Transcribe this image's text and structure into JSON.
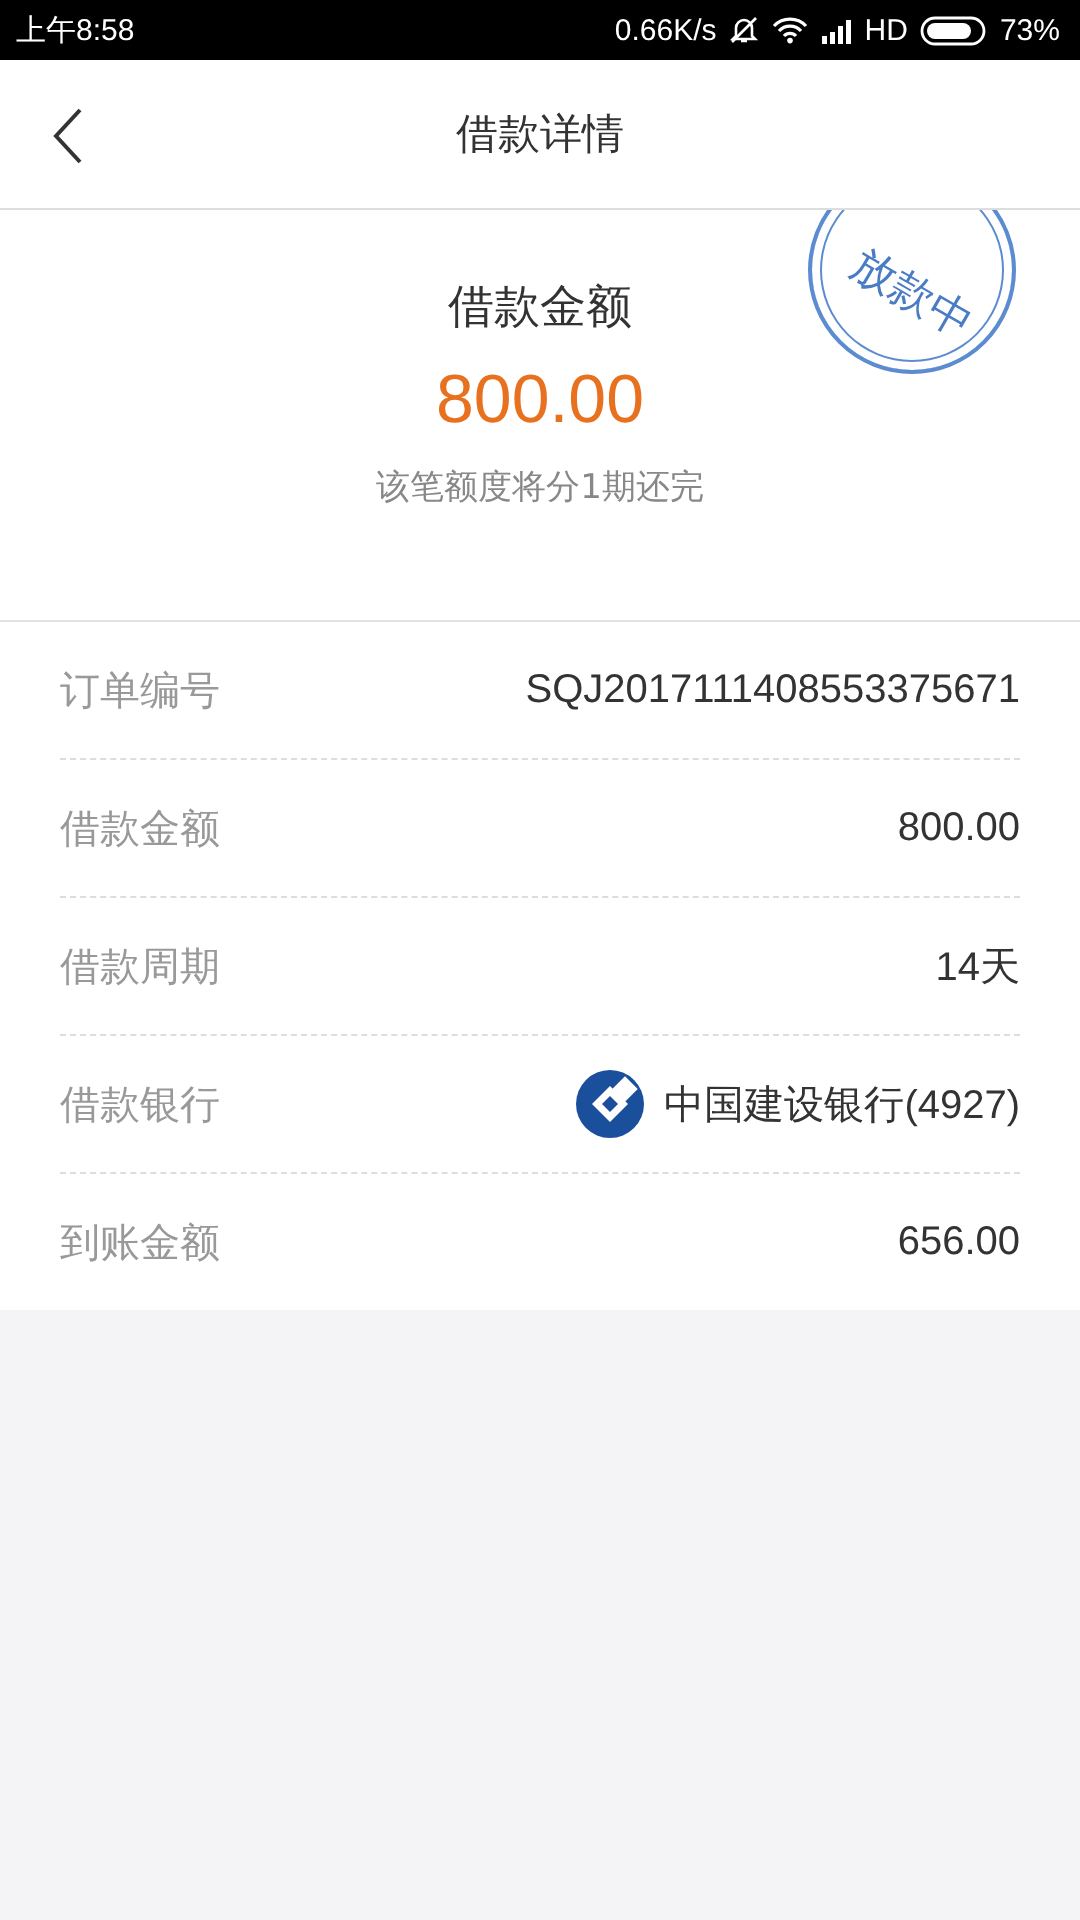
{
  "status_bar": {
    "time": "上午8:58",
    "speed": "0.66K/s",
    "network": "HD",
    "battery": "73%"
  },
  "header": {
    "title": "借款详情"
  },
  "summary": {
    "label": "借款金额",
    "amount": "800.00",
    "note": "该笔额度将分1期还完",
    "stamp": "放款中"
  },
  "rows": [
    {
      "kind": "text",
      "label": "订单编号",
      "value": "SQJ2017111408553375671"
    },
    {
      "kind": "text",
      "label": "借款金额",
      "value": "800.00"
    },
    {
      "kind": "text",
      "label": "借款周期",
      "value": "14天"
    },
    {
      "kind": "bank",
      "label": "借款银行",
      "value": "中国建设银行(4927)"
    },
    {
      "kind": "text",
      "label": "到账金额",
      "value": "656.00"
    }
  ]
}
